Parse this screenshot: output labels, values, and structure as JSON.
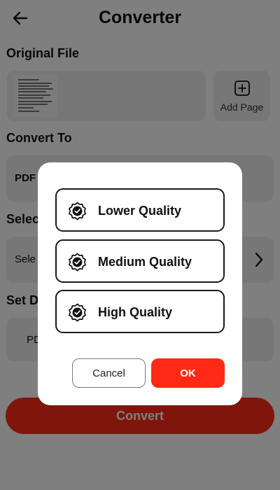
{
  "header": {
    "title": "Converter",
    "back_icon": "arrow-left-icon"
  },
  "sections": {
    "original_file": "Original File",
    "convert_to": "Convert To",
    "select": "Selec",
    "set_destination": "Set D"
  },
  "add_page": {
    "icon": "plus-square-icon",
    "label": "Add Page"
  },
  "convert_to": {
    "value": "PDF"
  },
  "select_field": {
    "value": "Sele",
    "icon": "chevron-right-icon"
  },
  "destination": {
    "value": "PD"
  },
  "convert_button": {
    "label": "Convert"
  },
  "dialog": {
    "options": [
      {
        "label": "Lower Quality",
        "icon": "verified-badge-icon"
      },
      {
        "label": "Medium Quality",
        "icon": "verified-badge-icon"
      },
      {
        "label": "High Quality",
        "icon": "verified-badge-icon"
      }
    ],
    "cancel_label": "Cancel",
    "ok_label": "OK"
  },
  "colors": {
    "accent": "#ff2a16",
    "card": "#eeeeee",
    "overlay": "rgba(0,0,0,0.5)",
    "text": "#111111"
  }
}
